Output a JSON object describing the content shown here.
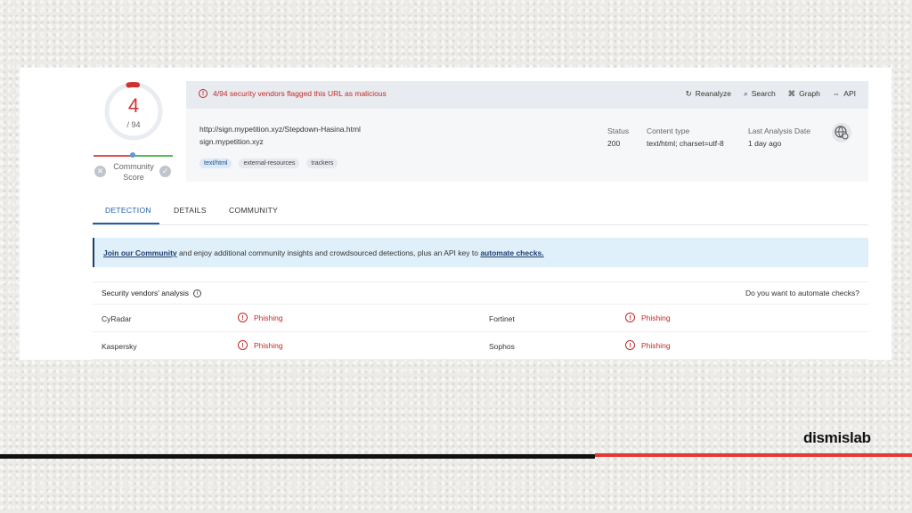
{
  "score": {
    "value": "4",
    "total": "/ 94",
    "fraction": 0.0426
  },
  "community": {
    "label_line1": "Community",
    "label_line2": "Score",
    "down_icon": "x-icon",
    "up_icon": "check-icon"
  },
  "alert": {
    "icon": "alert-icon",
    "text": "4/94 security vendors flagged this URL as malicious"
  },
  "actions": [
    {
      "icon": "reanalyze-icon",
      "glyph": "↻",
      "label": "Reanalyze"
    },
    {
      "icon": "search-icon",
      "glyph": "⌕",
      "label": "Search"
    },
    {
      "icon": "graph-icon",
      "glyph": "⌘",
      "label": "Graph"
    },
    {
      "icon": "api-icon",
      "glyph": "⇔",
      "label": "API"
    }
  ],
  "info": {
    "url": "http://sign.mypetition.xyz/Stepdown-Hasina.html",
    "domain": "sign.mypetition.xyz",
    "tags": [
      "text/html",
      "external-resources",
      "trackers"
    ],
    "status_label": "Status",
    "status_value": "200",
    "content_label": "Content type",
    "content_value": "text/html; charset=utf-8",
    "date_label": "Last Analysis Date",
    "date_value": "1 day ago"
  },
  "tabs": [
    "DETECTION",
    "DETAILS",
    "COMMUNITY"
  ],
  "banner": {
    "link1": "Join our Community",
    "middle": " and enjoy additional community insights and crowdsourced detections, plus an API key to ",
    "link2": "automate checks."
  },
  "vendors": {
    "title": "Security vendors' analysis",
    "automate": "Do you want to automate checks?",
    "rows": [
      {
        "left_name": "CyRadar",
        "left_result": "Phishing",
        "right_name": "Fortinet",
        "right_result": "Phishing"
      },
      {
        "left_name": "Kaspersky",
        "left_result": "Phishing",
        "right_name": "Sophos",
        "right_result": "Phishing"
      }
    ]
  },
  "footer": {
    "logo": "dismislab"
  },
  "colors": {
    "malicious": "#c62828",
    "accent": "#1f5fa8",
    "brand_red": "#e53935"
  }
}
